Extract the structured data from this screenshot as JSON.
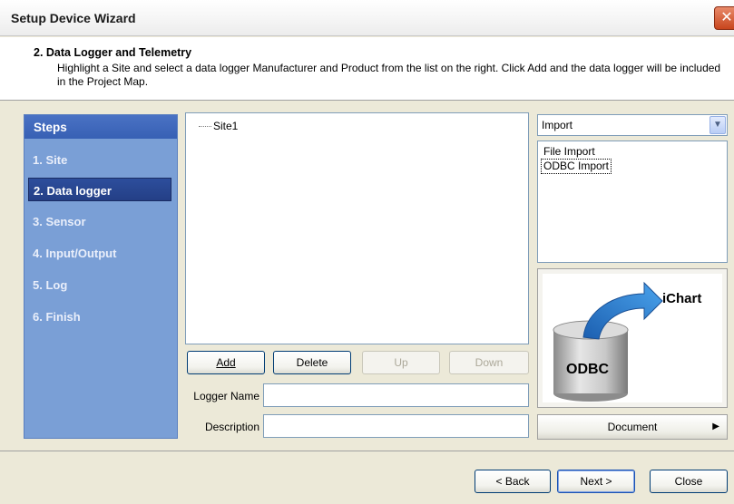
{
  "window": {
    "title": "Setup Device Wizard",
    "close_glyph": "✕"
  },
  "header": {
    "title": "2. Data Logger and Telemetry",
    "description": "Highlight a Site and select a data logger Manufacturer and Product from the list on the right. Click Add and the data logger will be included in the Project Map."
  },
  "steps": {
    "header": "Steps",
    "items": [
      {
        "label": "1. Site"
      },
      {
        "label": "2. Data logger",
        "active": true
      },
      {
        "label": "3. Sensor"
      },
      {
        "label": "4. Input/Output"
      },
      {
        "label": "5. Log"
      },
      {
        "label": "6. Finish"
      }
    ]
  },
  "tree": {
    "nodes": [
      {
        "label": "Site1"
      }
    ]
  },
  "buttons": {
    "add": "Add",
    "delete": "Delete",
    "up": "Up",
    "down": "Down"
  },
  "fields": {
    "logger_name_label": "Logger Name",
    "logger_name_value": "",
    "description_label": "Description",
    "description_value": ""
  },
  "import": {
    "selected": "Import",
    "options": [
      "File Import",
      "ODBC Import"
    ],
    "selected_option": "ODBC Import"
  },
  "illustration": {
    "source_label": "ODBC",
    "target_label": "iChart"
  },
  "document_button": "Document",
  "footer": {
    "back": "< Back",
    "next": "Next >",
    "close": "Close"
  },
  "colors": {
    "steps_panel": "#7a9fd6",
    "steps_active": "#2d4e9c",
    "arrow_blue": "#2f7fd0"
  }
}
